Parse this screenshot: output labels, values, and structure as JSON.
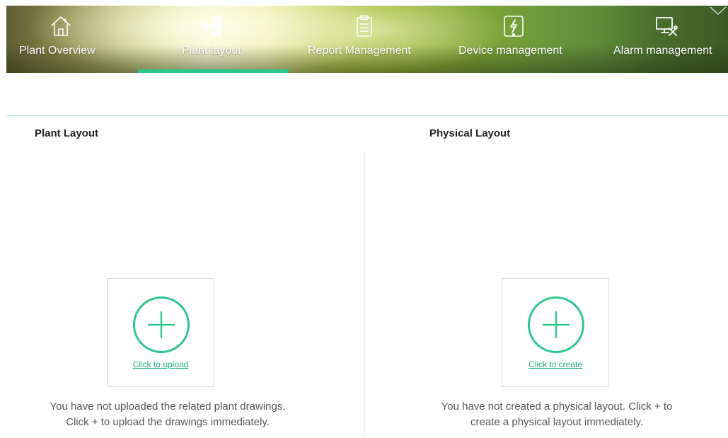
{
  "nav": {
    "tabs": [
      {
        "label": "Plant Overview",
        "icon": "home-icon",
        "active": false
      },
      {
        "label": "Plant layout",
        "icon": "layout-icon",
        "active": true
      },
      {
        "label": "Report Management",
        "icon": "clipboard-icon",
        "active": false
      },
      {
        "label": "Device management",
        "icon": "device-icon",
        "active": false
      },
      {
        "label": "Alarm management",
        "icon": "monitor-tools-icon",
        "active": false
      }
    ],
    "toggle_icon": "chevron-down-icon",
    "active_color": "#2fc68c"
  },
  "plant_layout": {
    "title": "Plant Layout",
    "link": "Click to upload",
    "hint_line1": "You have not uploaded the related plant drawings.",
    "hint_line2": "Click + to upload the drawings immediately."
  },
  "physical_layout": {
    "title": "Physical Layout",
    "link": "Click to create",
    "hint_line1": "You have not created a physical layout. Click + to",
    "hint_line2": "create a physical layout immediately."
  },
  "colors": {
    "accent": "#2fc68c",
    "link": "#19b07a",
    "rule": "#a9e8d0"
  }
}
